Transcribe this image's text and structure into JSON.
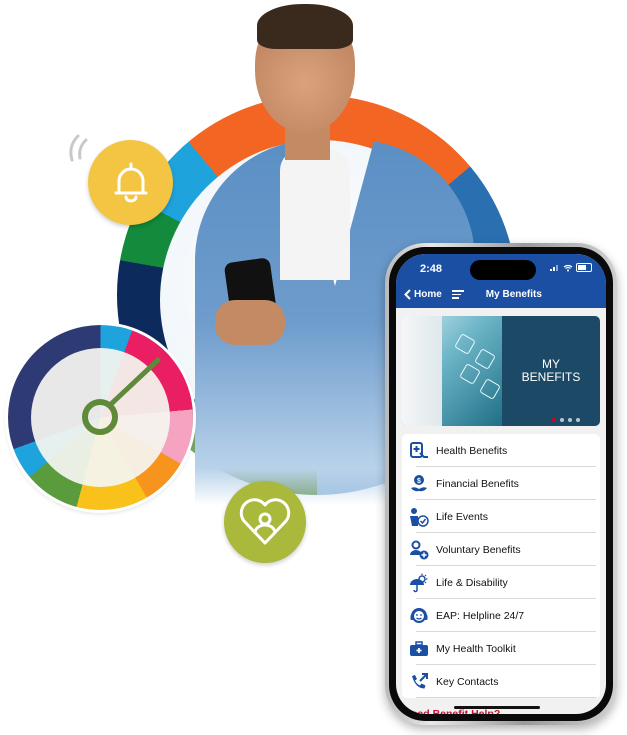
{
  "phone": {
    "status": {
      "time": "2:48"
    },
    "nav": {
      "back_label": "Home",
      "title": "My Benefits"
    },
    "banner": {
      "line1": "MY",
      "line2": "BENEFITS",
      "slides": 4,
      "active_slide": 1
    },
    "menu": [
      {
        "label": "Health Benefits",
        "icon": "health-tablet-icon"
      },
      {
        "label": "Financial Benefits",
        "icon": "money-plant-icon"
      },
      {
        "label": "Life Events",
        "icon": "person-check-icon"
      },
      {
        "label": "Voluntary Benefits",
        "icon": "person-plus-icon"
      },
      {
        "label": "Life & Disability",
        "icon": "umbrella-sun-icon"
      },
      {
        "label": "EAP: Helpline 24/7",
        "icon": "headset-icon"
      },
      {
        "label": "My Health Toolkit",
        "icon": "medical-kit-icon"
      },
      {
        "label": "Key Contacts",
        "icon": "phone-arrow-icon"
      }
    ],
    "help_text": "Need Benefit Help?"
  },
  "colors": {
    "header_blue": "#1a4fa3",
    "icon_blue": "#1a4fa3",
    "help_red": "#c4122f",
    "bell_yellow": "#f4c542",
    "heart_green": "#aab83c",
    "ring_orange": "#f26522"
  }
}
